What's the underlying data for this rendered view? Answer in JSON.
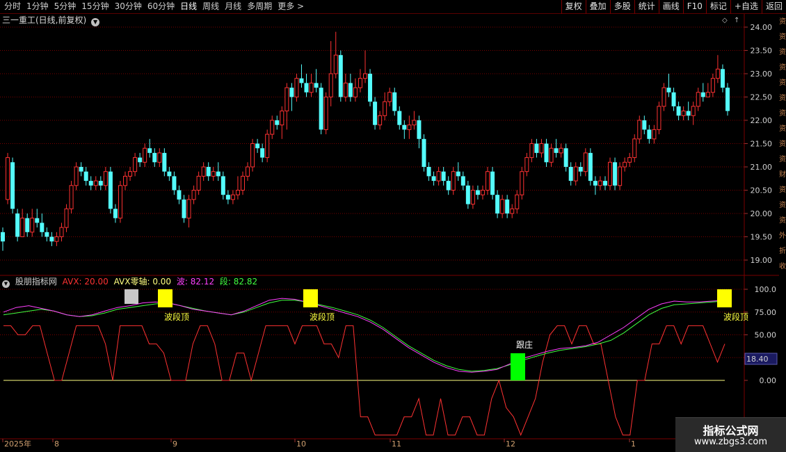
{
  "toolbar": {
    "periods": [
      "分时",
      "1分钟",
      "5分钟",
      "15分钟",
      "30分钟",
      "60分钟",
      "日线",
      "周线",
      "月线",
      "多周期",
      "更多 >"
    ],
    "active_period": "日线",
    "tools": [
      "复权",
      "叠加",
      "多股",
      "统计",
      "画线",
      "F10",
      "标记",
      "+自选",
      "返回"
    ]
  },
  "main_chart": {
    "title": "三一重工(日线,前复权)",
    "dropdown_icon": "chevron-down-icon",
    "y_ticks": [
      "24.00",
      "23.50",
      "23.00",
      "22.50",
      "22.00",
      "21.50",
      "21.00",
      "20.50",
      "20.00",
      "19.50",
      "19.00"
    ],
    "y_values": [
      24.0,
      23.5,
      23.0,
      22.5,
      22.0,
      21.5,
      21.0,
      20.5,
      20.0,
      19.5,
      19.0
    ],
    "up_color": "#ff3232",
    "down_color": "#54fcfc",
    "bg_color": "#000000",
    "grid_color": "#7a0000"
  },
  "indicator": {
    "name": "股朋指标网",
    "avx_label": "AVX: 20.00",
    "zero_label": "AVX零轴: 0.00",
    "wave_label": "波: 82.12",
    "seg_label": "段: 82.82",
    "avx_color": "#ff3232",
    "zero_color": "#ffff80",
    "wave_color": "#ff40ff",
    "seg_color": "#40ff40",
    "y_ticks": [
      "100.0",
      "75.00",
      "50.00",
      "25.00",
      "0.00"
    ],
    "y_values": [
      100,
      75,
      50,
      25,
      0
    ],
    "current_value": "18.40",
    "annotations": {
      "top_label": "波段顶",
      "follow_label": "跟庄"
    }
  },
  "date_axis": {
    "labels": [
      "2025年",
      "8",
      "9",
      "10",
      "11",
      "12",
      "1"
    ]
  },
  "side_strip": {
    "chars": [
      "资",
      "资",
      "资",
      "资",
      "资",
      "资",
      "资",
      "资",
      "资",
      "资",
      "财",
      "资",
      "资",
      "资",
      "外",
      "折",
      "收"
    ]
  },
  "watermark": {
    "title": "指标公式网",
    "url": "www.zbgs3.com"
  },
  "chart_data": {
    "type": "candlestick",
    "candles": [
      [
        19.6,
        19.4,
        19.7,
        19.2
      ],
      [
        20.3,
        21.2,
        21.3,
        20.2
      ],
      [
        21.1,
        20.1,
        21.2,
        20.0
      ],
      [
        20.0,
        19.5,
        20.1,
        19.4
      ],
      [
        19.5,
        19.9,
        20.1,
        19.5
      ],
      [
        19.9,
        19.6,
        20.0,
        19.5
      ],
      [
        19.6,
        19.9,
        20.1,
        19.5
      ],
      [
        19.9,
        19.8,
        20.1,
        19.7
      ],
      [
        19.8,
        19.6,
        20.0,
        19.5
      ],
      [
        19.6,
        19.5,
        19.7,
        19.4
      ],
      [
        19.5,
        19.4,
        19.6,
        19.3
      ],
      [
        19.4,
        19.5,
        19.6,
        19.3
      ],
      [
        19.5,
        19.7,
        19.8,
        19.4
      ],
      [
        19.7,
        20.1,
        20.2,
        19.6
      ],
      [
        20.1,
        20.6,
        20.7,
        20.0
      ],
      [
        20.6,
        21.0,
        21.1,
        20.5
      ],
      [
        21.0,
        20.9,
        21.1,
        20.8
      ],
      [
        20.9,
        20.7,
        21.0,
        20.6
      ],
      [
        20.7,
        20.6,
        20.8,
        20.5
      ],
      [
        20.6,
        20.7,
        20.8,
        20.5
      ],
      [
        20.7,
        20.6,
        20.8,
        20.5
      ],
      [
        20.6,
        20.9,
        21.0,
        20.5
      ],
      [
        20.9,
        20.1,
        21.0,
        20.0
      ],
      [
        20.1,
        19.9,
        20.2,
        19.8
      ],
      [
        19.9,
        20.6,
        20.7,
        19.8
      ],
      [
        20.6,
        20.8,
        20.9,
        20.5
      ],
      [
        20.8,
        20.9,
        21.0,
        20.7
      ],
      [
        20.9,
        21.2,
        21.3,
        20.8
      ],
      [
        21.2,
        21.1,
        21.3,
        21.0
      ],
      [
        21.1,
        21.4,
        21.5,
        21.0
      ],
      [
        21.4,
        21.3,
        21.6,
        21.2
      ],
      [
        21.3,
        21.1,
        21.4,
        21.0
      ],
      [
        21.1,
        21.3,
        21.4,
        21.0
      ],
      [
        21.3,
        20.9,
        21.4,
        20.8
      ],
      [
        20.9,
        20.8,
        21.0,
        20.7
      ],
      [
        20.8,
        20.5,
        20.9,
        20.4
      ],
      [
        20.5,
        20.3,
        20.6,
        20.2
      ],
      [
        20.3,
        19.9,
        20.4,
        19.8
      ],
      [
        19.9,
        20.3,
        20.4,
        19.7
      ],
      [
        20.3,
        20.5,
        20.6,
        20.2
      ],
      [
        20.5,
        20.8,
        20.9,
        20.4
      ],
      [
        20.8,
        21.0,
        21.1,
        20.7
      ],
      [
        21.0,
        20.8,
        21.1,
        20.7
      ],
      [
        20.8,
        20.9,
        21.0,
        20.7
      ],
      [
        20.9,
        20.8,
        21.1,
        20.7
      ],
      [
        20.8,
        20.4,
        20.9,
        20.3
      ],
      [
        20.4,
        20.3,
        20.5,
        20.2
      ],
      [
        20.3,
        20.4,
        20.5,
        20.2
      ],
      [
        20.4,
        20.5,
        20.8,
        20.3
      ],
      [
        20.5,
        20.8,
        20.9,
        20.4
      ],
      [
        20.8,
        21.0,
        21.1,
        20.7
      ],
      [
        21.0,
        21.5,
        21.6,
        20.9
      ],
      [
        21.5,
        21.4,
        21.6,
        21.3
      ],
      [
        21.4,
        21.2,
        21.5,
        21.1
      ],
      [
        21.2,
        21.7,
        21.8,
        21.1
      ],
      [
        21.7,
        22.0,
        22.1,
        21.6
      ],
      [
        22.0,
        21.9,
        22.1,
        21.8
      ],
      [
        21.9,
        22.2,
        22.3,
        21.6
      ],
      [
        22.2,
        22.7,
        22.8,
        21.8
      ],
      [
        22.7,
        22.5,
        22.8,
        22.2
      ],
      [
        22.5,
        22.9,
        23.0,
        22.4
      ],
      [
        22.9,
        22.8,
        23.2,
        22.7
      ],
      [
        22.8,
        22.6,
        23.0,
        22.5
      ],
      [
        22.6,
        22.8,
        23.0,
        22.5
      ],
      [
        22.8,
        22.7,
        23.1,
        22.6
      ],
      [
        22.7,
        21.8,
        22.8,
        21.7
      ],
      [
        21.8,
        22.5,
        22.6,
        21.7
      ],
      [
        22.5,
        23.0,
        23.7,
        22.3
      ],
      [
        23.0,
        23.4,
        23.9,
        22.9
      ],
      [
        23.4,
        22.5,
        23.5,
        22.4
      ],
      [
        22.5,
        22.8,
        23.0,
        22.4
      ],
      [
        22.8,
        22.5,
        23.0,
        22.4
      ],
      [
        22.5,
        22.7,
        22.9,
        22.4
      ],
      [
        22.7,
        22.9,
        23.1,
        22.6
      ],
      [
        22.9,
        23.0,
        23.5,
        22.8
      ],
      [
        23.0,
        22.4,
        23.1,
        22.3
      ],
      [
        22.4,
        21.9,
        22.5,
        21.8
      ],
      [
        21.9,
        22.1,
        22.2,
        21.8
      ],
      [
        22.1,
        22.4,
        22.6,
        22.0
      ],
      [
        22.4,
        22.6,
        22.7,
        22.3
      ],
      [
        22.6,
        22.2,
        22.7,
        22.1
      ],
      [
        22.2,
        21.9,
        22.3,
        21.8
      ],
      [
        21.9,
        21.8,
        22.0,
        21.6
      ],
      [
        21.8,
        21.9,
        22.1,
        21.6
      ],
      [
        21.9,
        22.0,
        22.2,
        21.8
      ],
      [
        22.0,
        21.6,
        22.1,
        21.4
      ],
      [
        21.6,
        21.0,
        21.7,
        20.9
      ],
      [
        21.0,
        20.8,
        21.1,
        20.7
      ],
      [
        20.8,
        20.7,
        20.9,
        20.6
      ],
      [
        20.7,
        20.9,
        21.0,
        20.6
      ],
      [
        20.9,
        20.7,
        21.0,
        20.6
      ],
      [
        20.7,
        20.5,
        20.8,
        20.4
      ],
      [
        20.5,
        20.9,
        21.0,
        20.4
      ],
      [
        20.9,
        20.8,
        21.1,
        20.7
      ],
      [
        20.8,
        20.6,
        20.9,
        20.5
      ],
      [
        20.6,
        20.2,
        20.7,
        20.1
      ],
      [
        20.2,
        20.5,
        20.6,
        20.1
      ],
      [
        20.5,
        20.4,
        20.6,
        20.3
      ],
      [
        20.4,
        20.5,
        20.6,
        20.3
      ],
      [
        20.5,
        20.9,
        21.0,
        20.4
      ],
      [
        20.9,
        20.4,
        21.0,
        20.3
      ],
      [
        20.4,
        20.0,
        20.5,
        19.9
      ],
      [
        20.0,
        20.3,
        20.4,
        19.9
      ],
      [
        20.3,
        20.0,
        20.4,
        19.9
      ],
      [
        20.0,
        20.1,
        20.2,
        19.9
      ],
      [
        20.1,
        20.4,
        20.5,
        20.0
      ],
      [
        20.4,
        20.9,
        21.0,
        20.3
      ],
      [
        20.9,
        21.2,
        21.3,
        20.8
      ],
      [
        21.2,
        21.5,
        21.6,
        21.1
      ],
      [
        21.5,
        21.3,
        21.6,
        21.2
      ],
      [
        21.3,
        21.5,
        21.6,
        21.2
      ],
      [
        21.5,
        21.1,
        21.6,
        21.0
      ],
      [
        21.1,
        21.4,
        21.5,
        21.0
      ],
      [
        21.4,
        21.3,
        21.6,
        21.2
      ],
      [
        21.3,
        21.4,
        21.5,
        21.2
      ],
      [
        21.4,
        21.0,
        21.5,
        20.9
      ],
      [
        21.0,
        20.7,
        21.1,
        20.6
      ],
      [
        20.7,
        21.0,
        21.1,
        20.6
      ],
      [
        21.0,
        20.9,
        21.1,
        20.8
      ],
      [
        20.9,
        21.3,
        21.4,
        20.8
      ],
      [
        21.3,
        20.7,
        21.4,
        20.6
      ],
      [
        20.7,
        20.6,
        20.8,
        20.4
      ],
      [
        20.6,
        20.7,
        20.8,
        20.5
      ],
      [
        20.7,
        20.6,
        20.8,
        20.5
      ],
      [
        20.6,
        21.1,
        21.2,
        20.5
      ],
      [
        21.1,
        20.6,
        21.2,
        20.5
      ],
      [
        20.6,
        21.0,
        21.1,
        20.5
      ],
      [
        21.0,
        21.1,
        21.2,
        20.9
      ],
      [
        21.1,
        21.2,
        21.3,
        21.0
      ],
      [
        21.2,
        21.6,
        21.7,
        21.1
      ],
      [
        21.6,
        22.0,
        22.1,
        21.5
      ],
      [
        22.0,
        21.8,
        22.1,
        21.7
      ],
      [
        21.8,
        21.6,
        21.9,
        21.5
      ],
      [
        21.6,
        21.8,
        21.9,
        21.5
      ],
      [
        21.8,
        22.3,
        22.4,
        21.7
      ],
      [
        22.3,
        22.7,
        22.8,
        22.2
      ],
      [
        22.7,
        22.6,
        23.0,
        22.5
      ],
      [
        22.6,
        22.3,
        22.7,
        22.2
      ],
      [
        22.3,
        22.1,
        22.4,
        22.0
      ],
      [
        22.1,
        22.2,
        22.3,
        22.0
      ],
      [
        22.2,
        22.1,
        22.4,
        22.0
      ],
      [
        22.1,
        22.3,
        22.4,
        21.9
      ],
      [
        22.3,
        22.6,
        22.7,
        22.2
      ],
      [
        22.6,
        22.5,
        22.8,
        22.4
      ],
      [
        22.5,
        22.6,
        22.8,
        22.5
      ],
      [
        22.6,
        22.9,
        23.0,
        22.5
      ],
      [
        22.9,
        23.1,
        23.4,
        22.8
      ],
      [
        23.1,
        22.7,
        23.2,
        22.6
      ],
      [
        22.7,
        22.2,
        22.8,
        22.1
      ]
    ],
    "series": [
      {
        "name": "AVX",
        "values": [
          60,
          60,
          50,
          50,
          60,
          60,
          30,
          0,
          0,
          30,
          60,
          60,
          60,
          60,
          40,
          0,
          60,
          60,
          60,
          60,
          40,
          40,
          30,
          0,
          0,
          0,
          40,
          60,
          60,
          40,
          0,
          0,
          30,
          30,
          0,
          30,
          60,
          60,
          60,
          60,
          40,
          60,
          60,
          60,
          40,
          40,
          25,
          60,
          60,
          -40,
          -40,
          -60,
          -60,
          -60,
          -60,
          -40,
          -40,
          -20,
          -60,
          -60,
          -20,
          -60,
          -60,
          -40,
          -40,
          -60,
          -60,
          -20,
          0,
          -30,
          -40,
          -60,
          -40,
          -20,
          20,
          50,
          60,
          60,
          40,
          60,
          60,
          40,
          40,
          0,
          -40,
          -60,
          -60,
          0,
          0,
          40,
          40,
          60,
          60,
          40,
          60,
          60,
          60,
          40,
          20,
          40
        ]
      },
      {
        "name": "AVX零轴",
        "values": [
          0
        ]
      },
      {
        "name": "波",
        "values": [
          75,
          80,
          82,
          79,
          76,
          72,
          70,
          72,
          76,
          80,
          82,
          85,
          86,
          85,
          82,
          78,
          76,
          74,
          72,
          76,
          82,
          88,
          90,
          89,
          86,
          82,
          78,
          74,
          70,
          64,
          56,
          46,
          36,
          28,
          20,
          14,
          10,
          9,
          10,
          12,
          18,
          24,
          28,
          32,
          35,
          36,
          38,
          42,
          50,
          58,
          68,
          78,
          84,
          87,
          86,
          86,
          87,
          88
        ]
      },
      {
        "name": "段",
        "values": [
          72,
          74,
          76,
          78,
          76,
          72,
          70,
          71,
          74,
          78,
          80,
          82,
          84,
          85,
          82,
          79,
          76,
          74,
          72,
          75,
          80,
          85,
          88,
          88,
          86,
          83,
          80,
          76,
          72,
          66,
          58,
          48,
          38,
          30,
          22,
          16,
          12,
          10,
          11,
          13,
          17,
          22,
          26,
          30,
          33,
          35,
          37,
          40,
          44,
          52,
          62,
          72,
          79,
          83,
          84,
          85,
          86,
          87
        ]
      }
    ]
  }
}
